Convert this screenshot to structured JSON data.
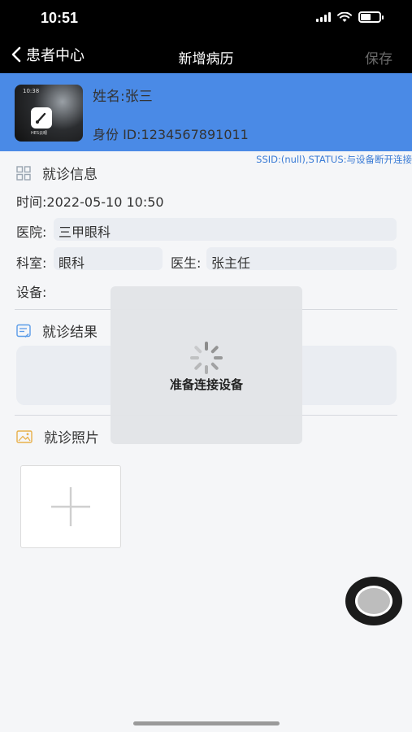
{
  "status_bar": {
    "time": "10:51"
  },
  "nav": {
    "back_label": "患者中心",
    "title": "新增病历",
    "save_label": "保存"
  },
  "patient": {
    "name": "姓名:张三",
    "id": "身份 ID:1234567891011",
    "avatar": {
      "time": "10:38",
      "app_label": "HES云眼"
    }
  },
  "connection_status": "SSID:(null),STATUS:与设备断开连接",
  "visit_info": {
    "title": "就诊信息",
    "time": "时间:2022-05-10 10:50",
    "hospital_label": "医院:",
    "hospital_value": "三甲眼科",
    "department_label": "科室:",
    "department_value": "眼科",
    "doctor_label": "医生:",
    "doctor_value": "张主任",
    "device_label": "设备:"
  },
  "results": {
    "title": "就诊结果"
  },
  "photos": {
    "title": "就诊照片"
  },
  "loading": {
    "text": "准备连接设备"
  },
  "colors": {
    "header_blue": "#4a8ae6",
    "link_blue": "#3a7bd5",
    "nav_black": "#000000"
  }
}
